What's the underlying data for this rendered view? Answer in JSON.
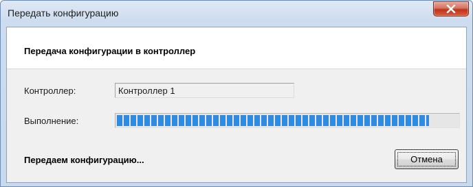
{
  "window": {
    "title": "Передать конфигурацию",
    "close_icon": "close-icon"
  },
  "header": {
    "text": "Передача конфигурации в контроллер"
  },
  "fields": {
    "controller_label": "Контроллер:",
    "controller_value": "Контроллер 1",
    "progress_label": "Выполнение:",
    "progress_fraction": 0.915
  },
  "status": {
    "text": "Передаем конфигурацию..."
  },
  "buttons": {
    "cancel_label": "Отмена"
  },
  "colors": {
    "progress_block": "#2f8ae0",
    "close_button": "#c73b21"
  }
}
